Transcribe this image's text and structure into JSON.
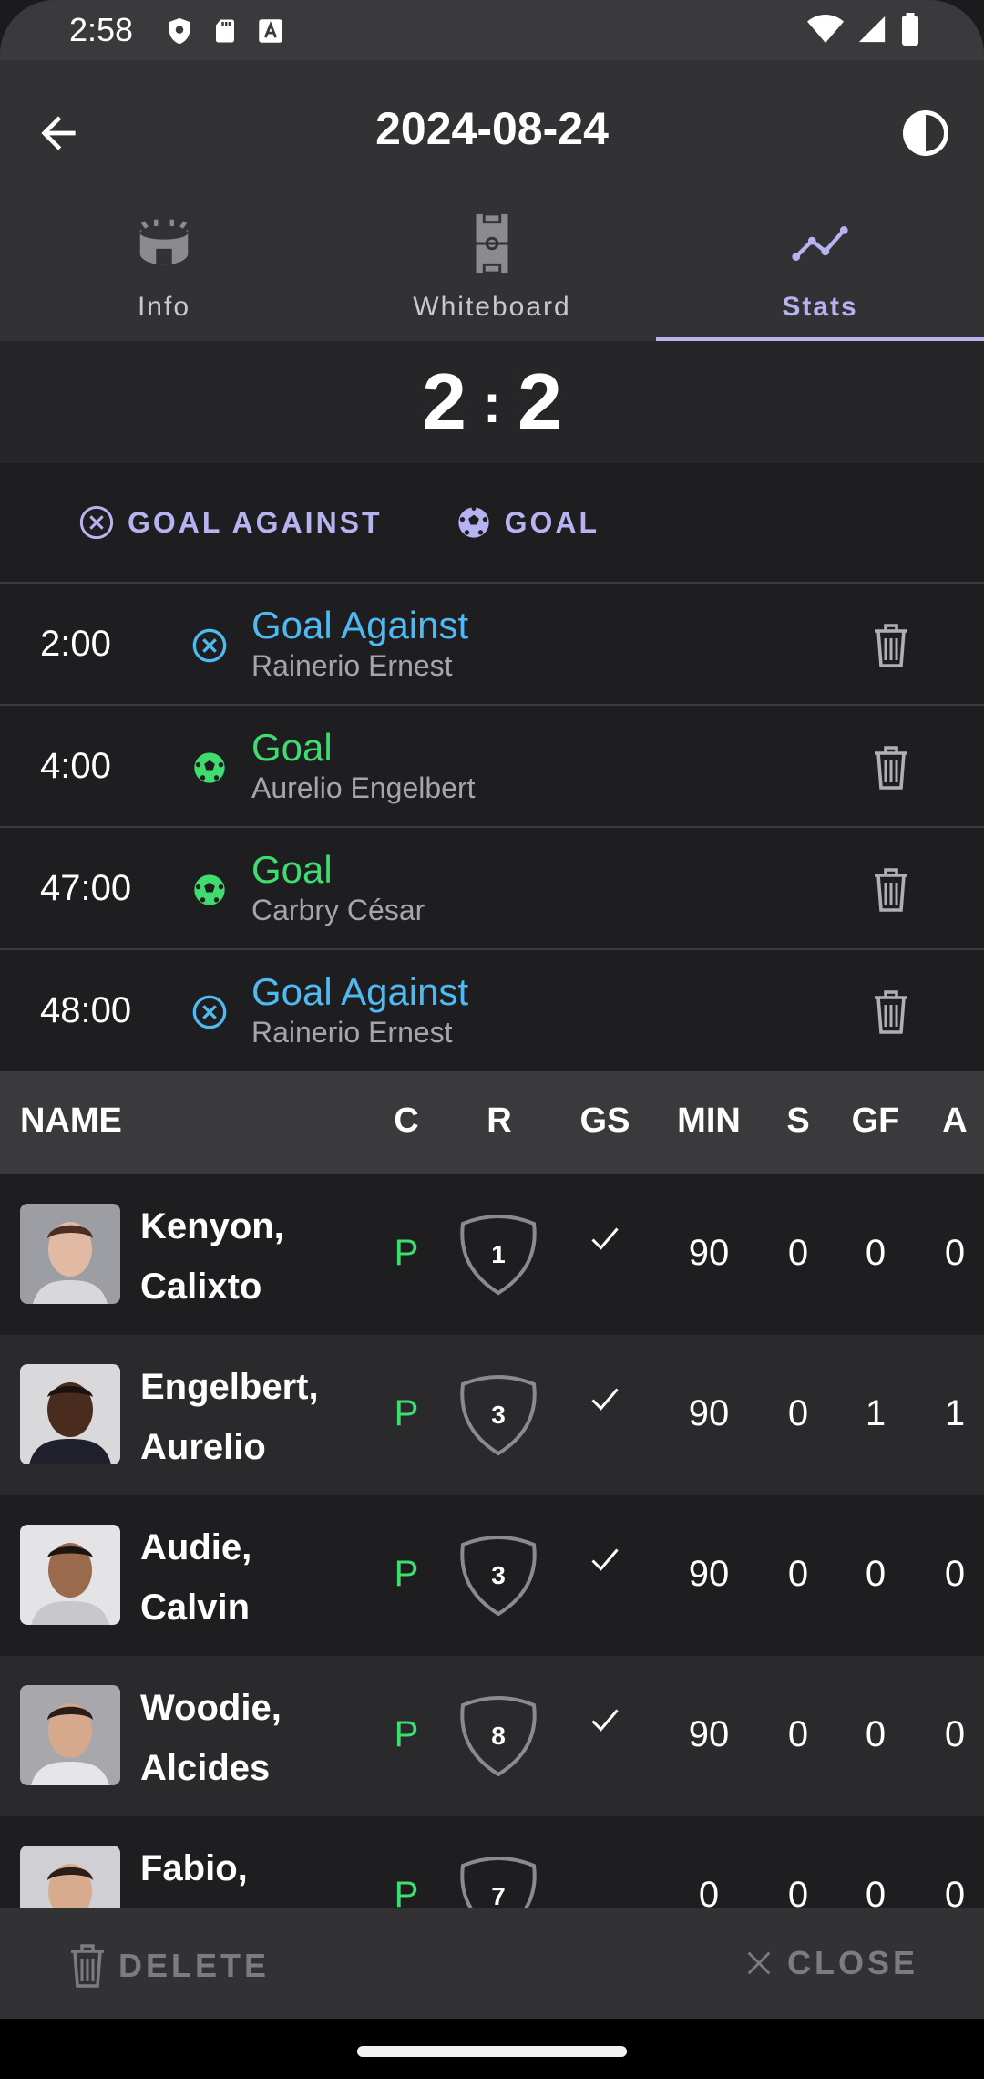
{
  "status_bar": {
    "time": "2:58"
  },
  "header": {
    "title": "2024-08-24"
  },
  "tabs": [
    {
      "label": "Info",
      "icon": "stadium-icon"
    },
    {
      "label": "Whiteboard",
      "icon": "field-board-icon"
    },
    {
      "label": "Stats",
      "icon": "line-chart-icon",
      "active": true
    }
  ],
  "score": {
    "home": "2",
    "separator": ":",
    "away": "2"
  },
  "actions": {
    "goal_against": "GOAL AGAINST",
    "goal": "GOAL"
  },
  "events": [
    {
      "time": "2:00",
      "type": "Goal Against",
      "player": "Rainerio Ernest"
    },
    {
      "time": "4:00",
      "type": "Goal",
      "player": "Aurelio Engelbert"
    },
    {
      "time": "47:00",
      "type": "Goal",
      "player": "Carbry César"
    },
    {
      "time": "48:00",
      "type": "Goal Against",
      "player": "Rainerio Ernest"
    }
  ],
  "table": {
    "headers": {
      "name": "NAME",
      "c": "C",
      "r": "R",
      "gs": "GS",
      "min": "MIN",
      "s": "S",
      "gf": "GF",
      "a": "A"
    },
    "rows": [
      {
        "name_line1": "Kenyon,",
        "name_line2": "Calixto",
        "c": "P",
        "r": "1",
        "gs": true,
        "min": "90",
        "s": "0",
        "gf": "0",
        "a": "0"
      },
      {
        "name_line1": "Engelbert,",
        "name_line2": "Aurelio",
        "c": "P",
        "r": "3",
        "gs": true,
        "min": "90",
        "s": "0",
        "gf": "1",
        "a": "1"
      },
      {
        "name_line1": "Audie,",
        "name_line2": "Calvin",
        "c": "P",
        "r": "3",
        "gs": true,
        "min": "90",
        "s": "0",
        "gf": "0",
        "a": "0"
      },
      {
        "name_line1": "Woodie,",
        "name_line2": "Alcides",
        "c": "P",
        "r": "8",
        "gs": true,
        "min": "90",
        "s": "0",
        "gf": "0",
        "a": "0"
      },
      {
        "name_line1": "Fabio,",
        "name_line2": "",
        "c": "P",
        "r": "7",
        "gs": false,
        "min": "0",
        "s": "0",
        "gf": "0",
        "a": "0"
      }
    ]
  },
  "bottom_bar": {
    "delete": "DELETE",
    "close": "CLOSE"
  },
  "colors": {
    "accent": "#b7b2f0",
    "goal": "#3fdc6f",
    "goal_against": "#4fb9f2"
  }
}
